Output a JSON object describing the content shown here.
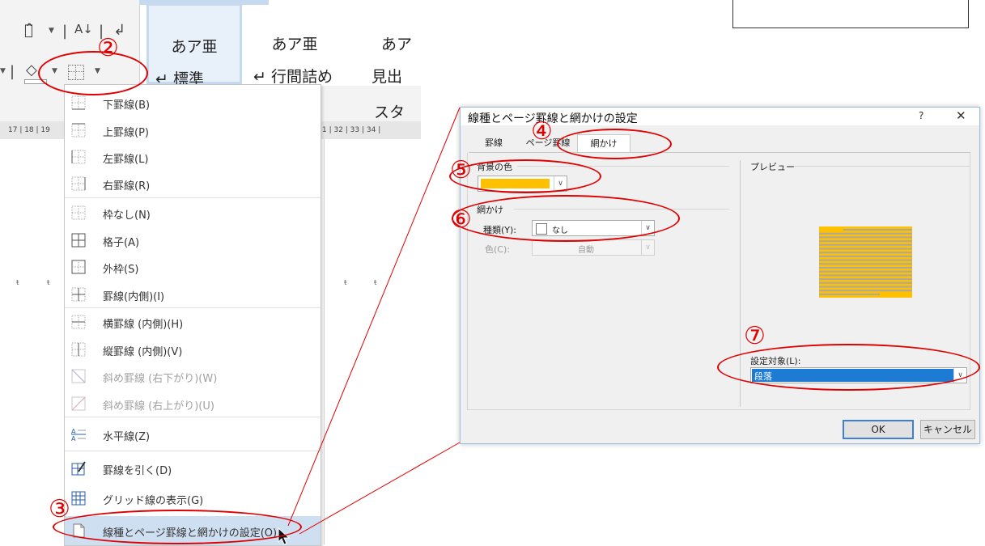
{
  "ribbon": {
    "style_samples": [
      "あア亜",
      "あア亜",
      "あア"
    ],
    "style_names": [
      "↵ 標準",
      "↵ 行間詰め",
      "見出"
    ],
    "group_label": "スタ",
    "ruler_left": "17 | 18 | 19",
    "ruler_right": "1 | 32 | 33 | 34 |",
    "doc_marks": [
      "ŧ",
      "ŧ",
      "ŧ",
      "ŧ"
    ]
  },
  "menu": {
    "items": [
      {
        "label": "下罫線(B)",
        "icon": "border-bottom-icon"
      },
      {
        "label": "上罫線(P)",
        "icon": "border-top-icon"
      },
      {
        "label": "左罫線(L)",
        "icon": "border-left-icon"
      },
      {
        "label": "右罫線(R)",
        "icon": "border-right-icon"
      },
      {
        "label": "枠なし(N)",
        "icon": "no-border-icon"
      },
      {
        "label": "格子(A)",
        "icon": "all-borders-icon"
      },
      {
        "label": "外枠(S)",
        "icon": "outside-borders-icon"
      },
      {
        "label": "罫線(内側)(I)",
        "icon": "inside-borders-icon"
      },
      {
        "label": "横罫線 (内側)(H)",
        "icon": "inside-horizontal-icon"
      },
      {
        "label": "縦罫線 (内側)(V)",
        "icon": "inside-vertical-icon"
      },
      {
        "label": "斜め罫線 (右下がり)(W)",
        "icon": "diagonal-down-icon"
      },
      {
        "label": "斜め罫線 (右上がり)(U)",
        "icon": "diagonal-up-icon"
      },
      {
        "label": "水平線(Z)",
        "icon": "horizontal-line-icon"
      },
      {
        "label": "罫線を引く(D)",
        "icon": "draw-table-icon"
      },
      {
        "label": "グリッド線の表示(G)",
        "icon": "view-gridlines-icon"
      },
      {
        "label": "線種とページ罫線と網かけの設定(O)...",
        "icon": "borders-shading-icon"
      }
    ]
  },
  "dialog": {
    "title": "線種とページ罫線と網かけの設定",
    "help": "?",
    "close": "✕",
    "tabs": [
      "罫線",
      "ページ罫線",
      "網かけ"
    ],
    "fill_label": "背景の色",
    "fill_color": "#FFC000",
    "pattern_group": "網かけ",
    "style_label": "種類(Y):",
    "style_value": "なし",
    "color_label": "色(C):",
    "color_value": "自動",
    "preview_label": "プレビュー",
    "apply_label": "設定対象(L):",
    "apply_value": "段落",
    "ok": "OK",
    "cancel": "キャンセル"
  },
  "annotations": {
    "step2": "②",
    "step3": "③",
    "step4": "④",
    "step5": "⑤",
    "step6": "⑥",
    "step7": "⑦"
  },
  "colors": {
    "annotation": "#E00000",
    "selection": "#1E7BD3",
    "shading": "#FFC000"
  }
}
